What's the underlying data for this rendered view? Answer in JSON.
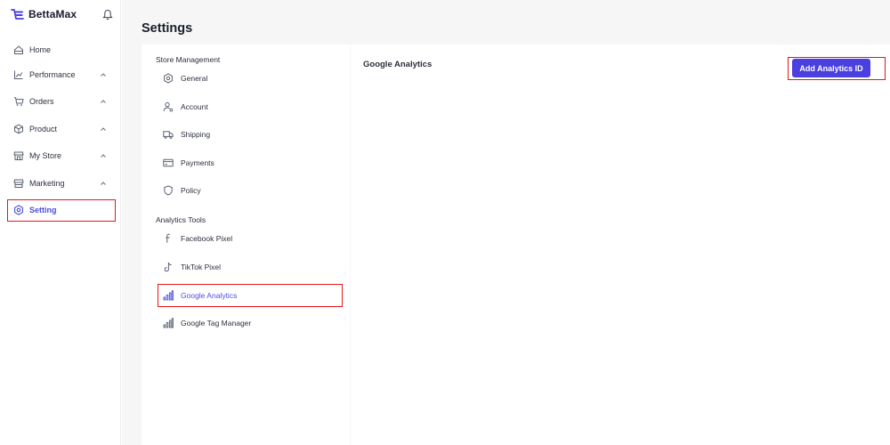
{
  "app": {
    "brand": "BettaMax"
  },
  "sidebar": {
    "items": [
      {
        "label": "Home",
        "icon": "home-icon",
        "expandable": false
      },
      {
        "label": "Performance",
        "icon": "chart-icon",
        "expandable": true
      },
      {
        "label": "Orders",
        "icon": "cart-icon",
        "expandable": true
      },
      {
        "label": "Product",
        "icon": "box-icon",
        "expandable": true
      },
      {
        "label": "My Store",
        "icon": "store-icon",
        "expandable": true
      },
      {
        "label": "Marketing",
        "icon": "megaphone-icon",
        "expandable": true
      },
      {
        "label": "Setting",
        "icon": "gear-icon",
        "expandable": false,
        "active": true
      }
    ]
  },
  "page": {
    "title": "Settings"
  },
  "settings_nav": {
    "store_management": {
      "heading": "Store Management",
      "items": [
        {
          "label": "General",
          "icon": "gear-icon"
        },
        {
          "label": "Account",
          "icon": "user-icon"
        },
        {
          "label": "Shipping",
          "icon": "truck-icon"
        },
        {
          "label": "Payments",
          "icon": "card-icon"
        },
        {
          "label": "Policy",
          "icon": "shield-icon"
        }
      ]
    },
    "analytics_tools": {
      "heading": "Analytics Tools",
      "items": [
        {
          "label": "Facebook Pixel",
          "icon": "facebook-icon"
        },
        {
          "label": "TikTok Pixel",
          "icon": "tiktok-icon"
        },
        {
          "label": "Google Analytics",
          "icon": "bar-chart-icon",
          "active": true
        },
        {
          "label": "Google Tag Manager",
          "icon": "bar-chart-icon"
        }
      ]
    }
  },
  "content": {
    "title": "Google Analytics",
    "add_button_label": "Add Analytics ID"
  },
  "colors": {
    "accent": "#4b3fe0",
    "active_text": "#4a4ee0",
    "highlight": "#e4161b",
    "main_bg": "#f6f6f7"
  }
}
